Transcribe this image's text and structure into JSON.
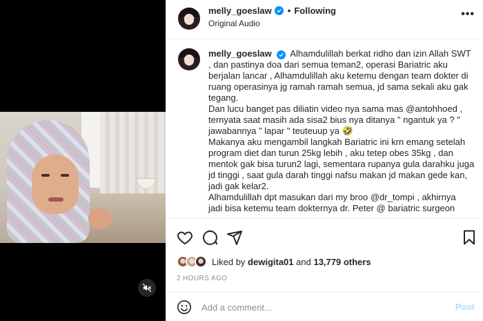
{
  "post": {
    "username": "melly_goeslaw",
    "follow_status": "Following",
    "dot": "•",
    "audio": "Original Audio",
    "more": "•••"
  },
  "caption": {
    "username": "melly_goeslaw",
    "lines": [
      "Alhamdulillah berkat ridho dan izin Allah SWT , dan pastinya doa dari semua teman2, operasi Bariatric aku berjalan lancar , Alhamdulillah aku ketemu dengan team dokter di ruang operasinya jg ramah ramah semua, jd sama sekali aku gak tegang.",
      "Dan lucu banget pas diliatin video nya sama mas @antohhoed , ternyata saat masih ada sisa2 bius nya ditanya \" ngantuk ya ? \" jawabannya \" lapar \" teuteuup ya 🤣",
      "Makanya aku mengambil langkah Bariatric ini krn emang setelah program diet dan turun 25kg lebih , aku tetep obes 35kg , dan mentok gak bisa turun2 lagi, sementara rupanya gula darahku juga jd tinggi , saat gula darah tinggi nafsu makan jd makan gede kan, jadi gak kelar2.",
      "Alhamdulillah dpt masukan dari my broo @dr_tompi , akhirnya",
      "jadi bisa ketemu team dokternya dr. Peter @ bariatric surgeon"
    ]
  },
  "likes": {
    "prefix": "Liked by",
    "user": "dewigita01",
    "conjunction": "and",
    "others": "13,779 others"
  },
  "timestamp": "2 HOURS AGO",
  "comment": {
    "placeholder": "Add a comment...",
    "post_label": "Post"
  },
  "icons": {
    "like": "heart-icon",
    "comment": "comment-icon",
    "share": "share-icon",
    "save": "bookmark-icon",
    "emoji": "smiley-icon",
    "mute": "speaker-muted-icon"
  },
  "colors": {
    "verified": "#0095f6",
    "post_disabled": "#b2dffc",
    "muted_text": "#8e8e8e"
  }
}
